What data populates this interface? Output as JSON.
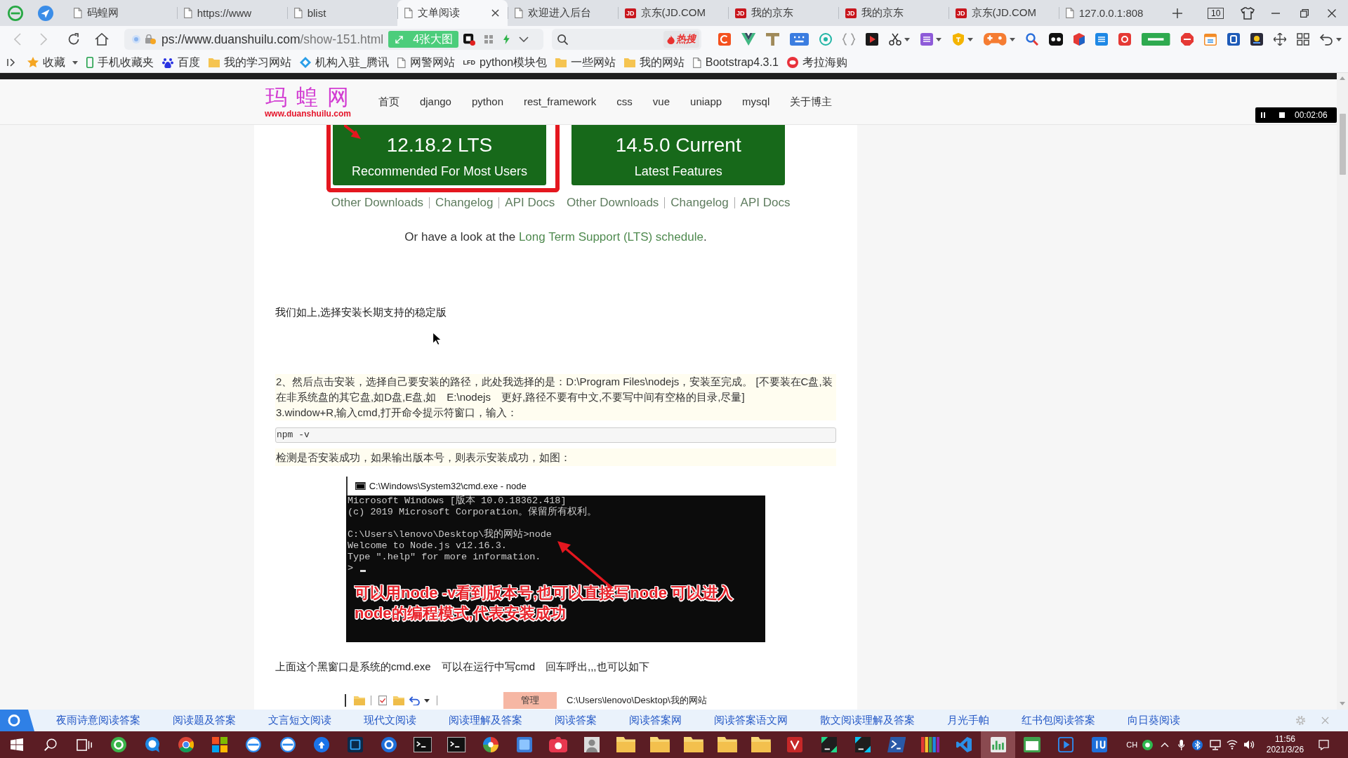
{
  "browser": {
    "tabs": [
      {
        "title": "码蝗网",
        "kind": "page",
        "selected": false
      },
      {
        "title": "https://www",
        "kind": "page",
        "selected": false
      },
      {
        "title": "blist",
        "kind": "page",
        "selected": false
      },
      {
        "title": "文单阅读",
        "kind": "page",
        "selected": true
      },
      {
        "title": "欢迎进入后台",
        "kind": "page",
        "selected": false
      },
      {
        "title": "京东(JD.COM",
        "kind": "logo",
        "logo": "JD",
        "selected": false
      },
      {
        "title": "我的京东",
        "kind": "logo",
        "logo": "JD",
        "selected": false
      },
      {
        "title": "我的京东",
        "kind": "logo",
        "logo": "JD",
        "selected": false
      },
      {
        "title": "京东(JD.COM",
        "kind": "logo",
        "logo": "JD",
        "selected": false
      },
      {
        "title": "127.0.0.1:808",
        "kind": "page",
        "selected": false
      }
    ],
    "tab_count": "10",
    "address": {
      "host": "ps://www.duanshuilu.com",
      "path": "/show-151.html"
    },
    "image_button": "4张大图",
    "hot_search": "热搜",
    "bookmarks": [
      {
        "label": "收藏",
        "kind": "favorites"
      },
      {
        "label": "手机收藏夹",
        "kind": "mobile"
      },
      {
        "label": "百度",
        "kind": "paw"
      },
      {
        "label": "我的学习网站",
        "kind": "folder"
      },
      {
        "label": "机构入驻_腾讯",
        "kind": "diamond"
      },
      {
        "label": "网警网站",
        "kind": "page"
      },
      {
        "label": "python模块包",
        "kind": "logo",
        "logo": "LFD"
      },
      {
        "label": "一些网站",
        "kind": "folder"
      },
      {
        "label": "我的网站",
        "kind": "folder"
      },
      {
        "label": "Bootstrap4.3.1",
        "kind": "page"
      },
      {
        "label": "考拉海购",
        "kind": "circle"
      }
    ]
  },
  "site": {
    "logo": "玛 蝗 网",
    "logo_subtitle": "www.duanshuilu.com",
    "nav": [
      "首页",
      "django",
      "python",
      "rest_framework",
      "css",
      "vue",
      "uniapp",
      "mysql",
      "关于博主"
    ]
  },
  "recorder": {
    "time": "00:02:06"
  },
  "article": {
    "downloads": [
      {
        "version": "12.18.2 LTS",
        "subtitle": "Recommended For Most Users",
        "highlighted": true,
        "links": [
          "Other Downloads",
          "Changelog",
          "API Docs"
        ]
      },
      {
        "version": "14.5.0 Current",
        "subtitle": "Latest Features",
        "highlighted": false,
        "links": [
          "Other Downloads",
          "Changelog",
          "API Docs"
        ]
      }
    ],
    "lts_note": {
      "text_before": "Or have a look at the ",
      "link": "Long Term Support (LTS) schedule",
      "text_after": "."
    },
    "blocks": [
      {
        "kind": "text",
        "text": "我们如上,选择安装长期支持的稳定版"
      },
      {
        "kind": "note",
        "lines": [
          "2、然后点击安装，选择自己要安装的路径，此处我选择的是：D:\\Program Files\\nodejs，安装至完成。 [不要装在C盘,装在非系统盘的其它盘,如D盘,E盘,如　E:\\nodejs　更好,路径不要有中文,不要写中间有空格的目录,尽量]",
          "3.window+R,输入cmd,打开命令提示符窗口，输入："
        ]
      },
      {
        "kind": "code",
        "text": "npm -v"
      },
      {
        "kind": "note",
        "lines": [
          "检测是否安装成功，如果输出版本号，则表示安装成功，如图："
        ]
      },
      {
        "kind": "terminal",
        "title": "C:\\Windows\\System32\\cmd.exe - node",
        "output": [
          [
            "Microsoft Windows [版本 10.0.18362.418]",
            "(c) 2019 Microsoft Corporation。保留所有权利。"
          ],
          [
            "C:\\Users\\lenovo\\Desktop\\我的网站>node",
            "Welcome to Node.js v12.16.3.",
            "Type \".help\" for more information."
          ]
        ],
        "prompt": ">",
        "annotation": [
          "可以用node -v看到版本号,也可以直接写node 可以进入",
          "node的编程模式,代表安装成功"
        ]
      },
      {
        "kind": "text",
        "text": "上面这个黑窗口是系统的cmd.exe　可以在运行中写cmd　回车呼出,,,也可以如下"
      },
      {
        "kind": "explorer",
        "tab": "管理",
        "path": "C:\\Users\\lenovo\\Desktop\\我的网站"
      }
    ]
  },
  "link_bar": {
    "links": [
      "夜雨诗意阅读答案",
      "阅读题及答案",
      "文言短文阅读",
      "现代文阅读",
      "阅读理解及答案",
      "阅读答案",
      "阅读答案网",
      "阅读答案语文网",
      "散文阅读理解及答案",
      "月光手帕",
      "红书包阅读答案",
      "向日葵阅读"
    ]
  },
  "taskbar": {
    "apps": [
      {
        "selected": false
      },
      {
        "selected": false
      },
      {
        "selected": false
      },
      {
        "selected": false
      },
      {
        "selected": false
      },
      {
        "selected": false
      },
      {
        "selected": false
      },
      {
        "selected": false
      },
      {
        "selected": false
      },
      {
        "selected": false
      },
      {
        "selected": false
      },
      {
        "selected": false
      },
      {
        "selected": false
      },
      {
        "selected": false
      },
      {
        "selected": false
      },
      {
        "selected": false
      },
      {
        "selected": false
      },
      {
        "selected": false
      },
      {
        "selected": false
      },
      {
        "selected": false
      },
      {
        "selected": false
      },
      {
        "selected": false
      },
      {
        "selected": false
      },
      {
        "selected": false
      },
      {
        "selected": false
      },
      {
        "selected": false
      },
      {
        "selected": true
      },
      {
        "selected": false
      },
      {
        "selected": false
      },
      {
        "selected": false
      }
    ],
    "language": "CH",
    "time": "11:56",
    "date": "2021/3/26"
  }
}
